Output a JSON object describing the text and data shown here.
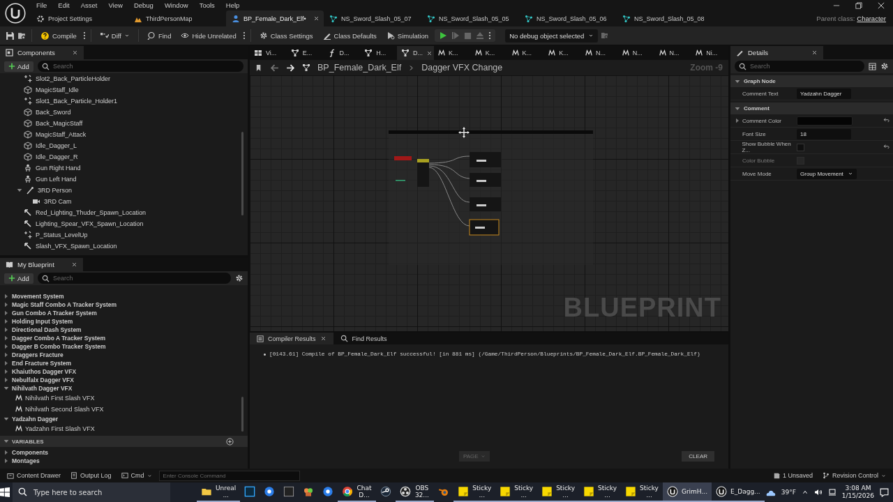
{
  "menu": [
    "File",
    "Edit",
    "Asset",
    "View",
    "Debug",
    "Window",
    "Tools",
    "Help"
  ],
  "doc_tabs": [
    {
      "label": "Project Settings",
      "kind": "settings",
      "selected": false
    },
    {
      "label": "ThirdPersonMap",
      "kind": "map",
      "selected": false
    },
    {
      "label": "BP_Female_Dark_Elf•",
      "kind": "blueprint",
      "selected": true
    },
    {
      "label": "NS_Sword_Slash_05_07",
      "kind": "niagara",
      "selected": false
    },
    {
      "label": "NS_Sword_Slash_05_05",
      "kind": "niagara",
      "selected": false
    },
    {
      "label": "NS_Sword_Slash_05_06",
      "kind": "niagara",
      "selected": false
    },
    {
      "label": "NS_Sword_Slash_05_08",
      "kind": "niagara",
      "selected": false
    }
  ],
  "parent_class": {
    "label": "Parent class:",
    "value": "Character"
  },
  "toolbar": {
    "compile": "Compile",
    "diff": "Diff",
    "find": "Find",
    "hide_unrelated": "Hide Unrelated",
    "class_settings": "Class Settings",
    "class_defaults": "Class Defaults",
    "simulation": "Simulation",
    "debug_object": "No debug object selected"
  },
  "components": {
    "title": "Components",
    "add": "Add",
    "search_placeholder": "Search",
    "items": [
      {
        "label": "Slot2_Back_ParticleHolder",
        "kind": "particle"
      },
      {
        "label": "MagicStaff_Idle",
        "kind": "mesh"
      },
      {
        "label": "Slot1_Back_Particle_Holder1",
        "kind": "particle"
      },
      {
        "label": "Back_Sword",
        "kind": "mesh"
      },
      {
        "label": "Back_MagicStaff",
        "kind": "mesh"
      },
      {
        "label": "MagicStaff_Attack",
        "kind": "mesh"
      },
      {
        "label": "Idle_Dagger_L",
        "kind": "mesh"
      },
      {
        "label": "Idle_Dagger_R",
        "kind": "mesh"
      },
      {
        "label": "Gun Right Hand",
        "kind": "skeleton"
      },
      {
        "label": "Gun Left Hand",
        "kind": "skeleton"
      },
      {
        "label": "3RD Person",
        "kind": "spring-arm",
        "expanded": true,
        "children": [
          {
            "label": "3RD Cam",
            "kind": "camera"
          }
        ]
      },
      {
        "label": "Red_Lighting_Thuder_Spawn_Location",
        "kind": "arrow"
      },
      {
        "label": "Lighting_Spear_VFX_Spawn_Location",
        "kind": "arrow"
      },
      {
        "label": "P_Status_LevelUp",
        "kind": "particle"
      },
      {
        "label": "Slash_VFX_Spawn_Location",
        "kind": "arrow"
      }
    ]
  },
  "my_blueprint": {
    "title": "My Blueprint",
    "add": "Add",
    "search_placeholder": "Search",
    "categories": [
      {
        "label": "Movement System",
        "expanded": false
      },
      {
        "label": "Magic Staff Combo A Tracker System",
        "expanded": false
      },
      {
        "label": "Gun Combo A Tracker System",
        "expanded": false
      },
      {
        "label": "Holding Input System",
        "expanded": false
      },
      {
        "label": "Directional Dash System",
        "expanded": false
      },
      {
        "label": "Dagger Combo A Tracker System",
        "expanded": false
      },
      {
        "label": "Dagger B Combo Tracker System",
        "expanded": false
      },
      {
        "label": "Draggers Fracture",
        "expanded": false
      },
      {
        "label": "End Fracture System",
        "expanded": false
      },
      {
        "label": "Khaiuthos Dagger VFX",
        "expanded": false
      },
      {
        "label": "Nebulfalx Dagger VFX",
        "expanded": false
      },
      {
        "label": "Nihilvath Dagger VFX",
        "expanded": true,
        "children": [
          {
            "label": "Nihilvath First Slash VFX"
          },
          {
            "label": "Nihilvath Second Slash VFX"
          }
        ]
      },
      {
        "label": "Yadzahn Dagger",
        "expanded": true,
        "children": [
          {
            "label": "Yadzahn First Slash VFX"
          }
        ]
      }
    ],
    "variables": {
      "title": "VARIABLES",
      "expanded": true,
      "items": [
        {
          "label": "Components",
          "expanded": false
        },
        {
          "label": "Montages",
          "expanded": false
        }
      ]
    }
  },
  "graph_tabs": [
    {
      "label": "Vi...",
      "kind": "viewport",
      "selected": false
    },
    {
      "label": "E...",
      "kind": "graph",
      "selected": false
    },
    {
      "label": "D...",
      "kind": "function",
      "selected": false
    },
    {
      "label": "H...",
      "kind": "graph",
      "selected": false
    },
    {
      "label": "D...",
      "kind": "graph",
      "selected": true
    },
    {
      "label": "K...",
      "kind": "macro",
      "selected": false
    },
    {
      "label": "K...",
      "kind": "macro",
      "selected": false
    },
    {
      "label": "K...",
      "kind": "macro",
      "selected": false
    },
    {
      "label": "K...",
      "kind": "macro",
      "selected": false
    },
    {
      "label": "N...",
      "kind": "macro",
      "selected": false
    },
    {
      "label": "N...",
      "kind": "macro",
      "selected": false
    },
    {
      "label": "N...",
      "kind": "macro",
      "selected": false
    },
    {
      "label": "Ni...",
      "kind": "macro",
      "selected": false
    }
  ],
  "breadcrumb": [
    "BP_Female_Dark_Elf",
    "Dagger VFX Change"
  ],
  "zoom": "Zoom -9",
  "graph_watermark": "BLUEPRINT",
  "compiler": {
    "tabs": [
      {
        "label": "Compiler Results",
        "selected": true
      },
      {
        "label": "Find Results",
        "selected": false
      }
    ],
    "messages": [
      "[0143.61] Compile of BP_Female_Dark_Elf successful! [in 881 ms] (/Game/ThirdPerson/Blueprints/BP_Female_Dark_Elf.BP_Female_Dark_Elf)"
    ],
    "page": "PAGE",
    "clear": "CLEAR"
  },
  "details": {
    "title": "Details",
    "search_placeholder": "Search",
    "sections": [
      {
        "title": "Graph Node",
        "expanded": true,
        "rows": [
          {
            "label": "Comment Text",
            "kind": "text",
            "value": "Yadzahn Dagger",
            "disabled": false,
            "reset": false
          }
        ]
      },
      {
        "title": "Comment",
        "expanded": true,
        "rows": [
          {
            "label": "Comment Color",
            "kind": "color",
            "expanded": false,
            "disabled": false,
            "reset": true
          },
          {
            "label": "Font Size",
            "kind": "text",
            "value": "18",
            "disabled": false,
            "reset": false
          },
          {
            "label": "Show Bubble When Z...",
            "kind": "checkbox",
            "checked": false,
            "disabled": false,
            "reset": true
          },
          {
            "label": "Color Bubble",
            "kind": "checkbox",
            "checked": false,
            "disabled": true,
            "reset": false
          },
          {
            "label": "Move Mode",
            "kind": "dropdown",
            "value": "Group Movement",
            "disabled": false,
            "reset": false
          }
        ]
      }
    ]
  },
  "status_bar": {
    "content_drawer": "Content Drawer",
    "output_log": "Output Log",
    "cmd": "Cmd",
    "console_placeholder": "Enter Console Command",
    "unsaved": "1 Unsaved",
    "revision_control": "Revision Control"
  },
  "taskbar": {
    "search_placeholder": "Type here to search",
    "apps": [
      {
        "kind": "folder",
        "label": "Unreal ...",
        "selected": false
      },
      {
        "kind": "square",
        "selected": false
      },
      {
        "kind": "circle",
        "selected": false
      },
      {
        "kind": "dark-square",
        "selected": false
      },
      {
        "kind": "mixer",
        "selected": false
      },
      {
        "kind": "circle",
        "selected": false
      },
      {
        "kind": "browser",
        "label": "Chat D...",
        "selected": false
      },
      {
        "kind": "steam",
        "selected": false
      },
      {
        "kind": "recorder",
        "label": "OBS 32...",
        "selected": false
      },
      {
        "kind": "blender",
        "selected": false
      },
      {
        "kind": "note",
        "label": "Sticky ...",
        "selected": false
      },
      {
        "kind": "note",
        "label": "Sticky ...",
        "selected": false
      },
      {
        "kind": "note",
        "label": "Sticky ...",
        "selected": false
      },
      {
        "kind": "note",
        "label": "Sticky ...",
        "selected": false
      },
      {
        "kind": "note",
        "label": "Sticky ...",
        "selected": false
      },
      {
        "kind": "unreal",
        "label": "GrimH...",
        "selected": true
      },
      {
        "kind": "unreal",
        "label": "E_Dagg...",
        "selected": false
      }
    ],
    "weather": "39°F",
    "time": "3:08 AM",
    "date": "1/15/2026"
  }
}
